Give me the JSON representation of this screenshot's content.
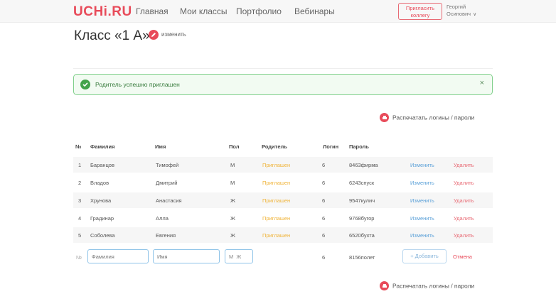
{
  "header": {
    "logo": "UCHi.RU",
    "nav": [
      "Главная",
      "Мои классы",
      "Портфолио",
      "Вебинары"
    ],
    "invite_line1": "Пригласить",
    "invite_line2": "коллегу",
    "user_line1": "Георгий",
    "user_line2": "Осипович"
  },
  "page": {
    "title": "Класс «1 А»",
    "edit_label": "изменить"
  },
  "alert": {
    "text": "Родитель успешно приглашен",
    "close": "×"
  },
  "print_label": "Распечатать логины / пароли",
  "table": {
    "headers": [
      "№",
      "Фамилия",
      "Имя",
      "Пол",
      "Родитель",
      "Логин",
      "Пароль"
    ],
    "rows": [
      {
        "num": "1",
        "surname": "Баранцов",
        "name": "Тимофей",
        "gender": "М",
        "parent": "Приглашен",
        "login": "6",
        "password": "8463фирма",
        "edit": "Изменить",
        "delete": "Удалить"
      },
      {
        "num": "2",
        "surname": "Владов",
        "name": "Дмитрий",
        "gender": "М",
        "parent": "Приглашен",
        "login": "6",
        "password": "6243спуск",
        "edit": "Изменить",
        "delete": "Удалить"
      },
      {
        "num": "3",
        "surname": "Хрунова",
        "name": "Анастасия",
        "gender": "Ж",
        "parent": "Приглашен",
        "login": "6",
        "password": "9547кулич",
        "edit": "Изменить",
        "delete": "Удалить"
      },
      {
        "num": "4",
        "surname": "Градинар",
        "name": "Алла",
        "gender": "Ж",
        "parent": "Приглашен",
        "login": "6",
        "password": "9768бугор",
        "edit": "Изменить",
        "delete": "Удалить"
      },
      {
        "num": "5",
        "surname": "Соболева",
        "name": "Евгения",
        "gender": "Ж",
        "parent": "Приглашен",
        "login": "6",
        "password": "6520бухта",
        "edit": "Изменить",
        "delete": "Удалить"
      }
    ]
  },
  "new_row": {
    "num": "№",
    "surname_placeholder": "Фамилия",
    "name_placeholder": "Имя",
    "gender_m": "М",
    "gender_f": "Ж",
    "login": "6",
    "password": "8156полет",
    "add_label": "+ Добавить",
    "cancel_label": "Отмена"
  },
  "colors": {
    "brand": "#e84b5a",
    "success": "#43a34b",
    "parent_invited": "#f0b43a",
    "link_blue": "#5aa0d8"
  }
}
